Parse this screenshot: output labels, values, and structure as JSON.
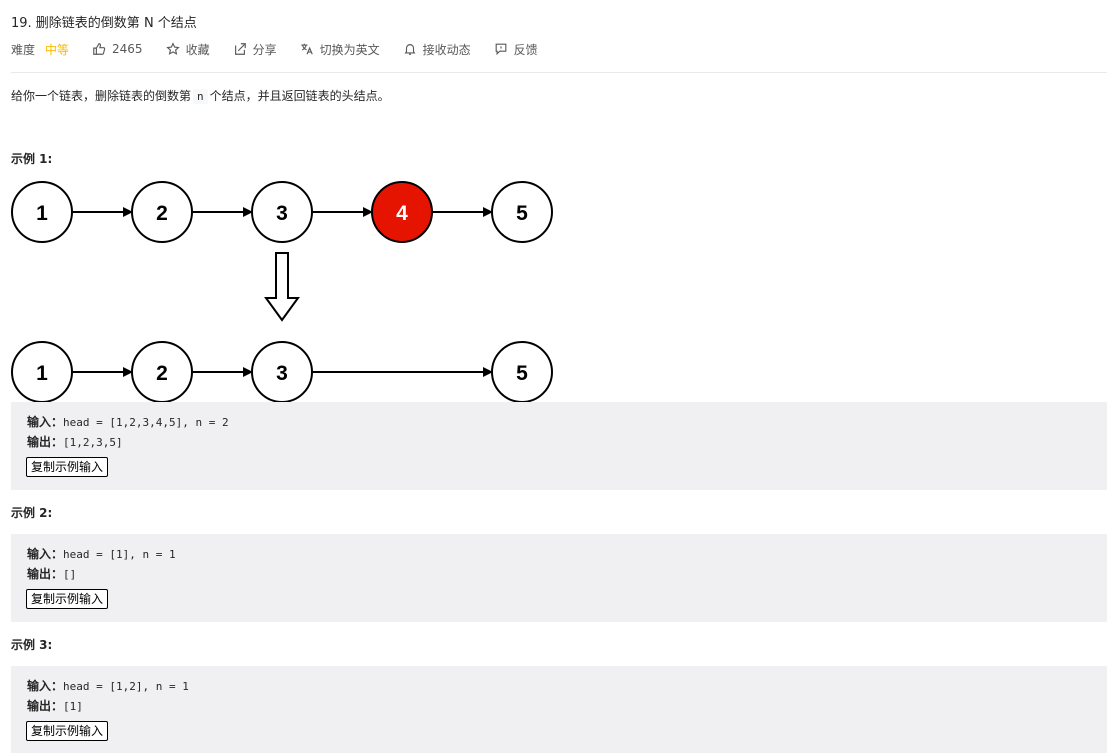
{
  "problem": {
    "title": "19. 删除链表的倒数第 N 个结点",
    "difficulty_label": "难度",
    "difficulty_value": "中等",
    "likes": "2465",
    "favorite_label": "收藏",
    "share_label": "分享",
    "switch_lang_label": "切换为英文",
    "notify_label": "接收动态",
    "feedback_label": "反馈",
    "description_before": "给你一个链表，删除链表的倒数第",
    "description_code": "n",
    "description_after": "个结点，并且返回链表的头结点。"
  },
  "colors": {
    "difficulty": "#ffb800",
    "highlight_node": "#e51400",
    "example_bg": "#f0f0f2"
  },
  "icons": {
    "likes": "thumbs-up-icon",
    "favorite": "star-icon",
    "share": "share-icon",
    "switch_lang": "translate-icon",
    "notify": "bell-icon",
    "feedback": "feedback-icon"
  },
  "diagram": {
    "top_row": [
      "1",
      "2",
      "3",
      "4",
      "5"
    ],
    "highlighted": "4",
    "bottom_row": [
      "1",
      "2",
      "3",
      "5"
    ]
  },
  "examples": [
    {
      "title": "示例 1:",
      "input_label": "输入：",
      "input": "head = [1,2,3,4,5], n = 2",
      "output_label": "输出：",
      "output": "[1,2,3,5]",
      "copy_label": "复制示例输入"
    },
    {
      "title": "示例 2:",
      "input_label": "输入：",
      "input": "head = [1], n = 1",
      "output_label": "输出：",
      "output": "[]",
      "copy_label": "复制示例输入"
    },
    {
      "title": "示例 3:",
      "input_label": "输入：",
      "input": "head = [1,2], n = 1",
      "output_label": "输出：",
      "output": "[1]",
      "copy_label": "复制示例输入"
    }
  ]
}
